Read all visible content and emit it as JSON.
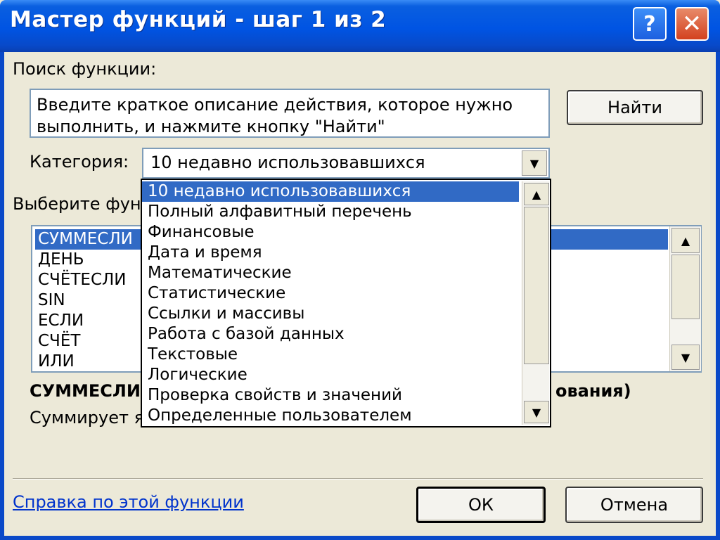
{
  "window": {
    "title": "Мастер функций - шаг 1 из 2",
    "help_symbol": "?",
    "close_symbol": "✕"
  },
  "search": {
    "label": "Поиск функции:",
    "text": "Введите краткое описание действия, которое нужно выполнить, и нажмите кнопку \"Найти\"",
    "find_button": "Найти"
  },
  "category": {
    "label": "Категория:",
    "selected": "10 недавно использовавшихся",
    "options": [
      "10 недавно использовавшихся",
      "Полный алфавитный перечень",
      "Финансовые",
      "Дата и время",
      "Математические",
      "Статистические",
      "Ссылки и массивы",
      "Работа с базой данных",
      "Текстовые",
      "Логические",
      "Проверка свойств и значений",
      "Определенные пользователем"
    ]
  },
  "function_list": {
    "label": "Выберите фун",
    "items": [
      "СУММЕСЛИ",
      "ДЕНЬ",
      "СЧЁТЕСЛИ",
      "SIN",
      "ЕСЛИ",
      "СЧЁТ",
      "ИЛИ"
    ]
  },
  "description": {
    "signature_start": "СУММЕСЛИ",
    "signature_end": "ования)",
    "text": "Суммирует я"
  },
  "footer": {
    "help_link": "Справка по этой функции",
    "ok_button": "ОК",
    "cancel_button": "Отмена"
  },
  "icons": {
    "arrow_down": "▼",
    "arrow_up": "▲"
  },
  "colors": {
    "titlebar": "#0054e3",
    "selection": "#316ac5",
    "dialog_bg": "#ece9d8",
    "link": "#0033cc"
  }
}
